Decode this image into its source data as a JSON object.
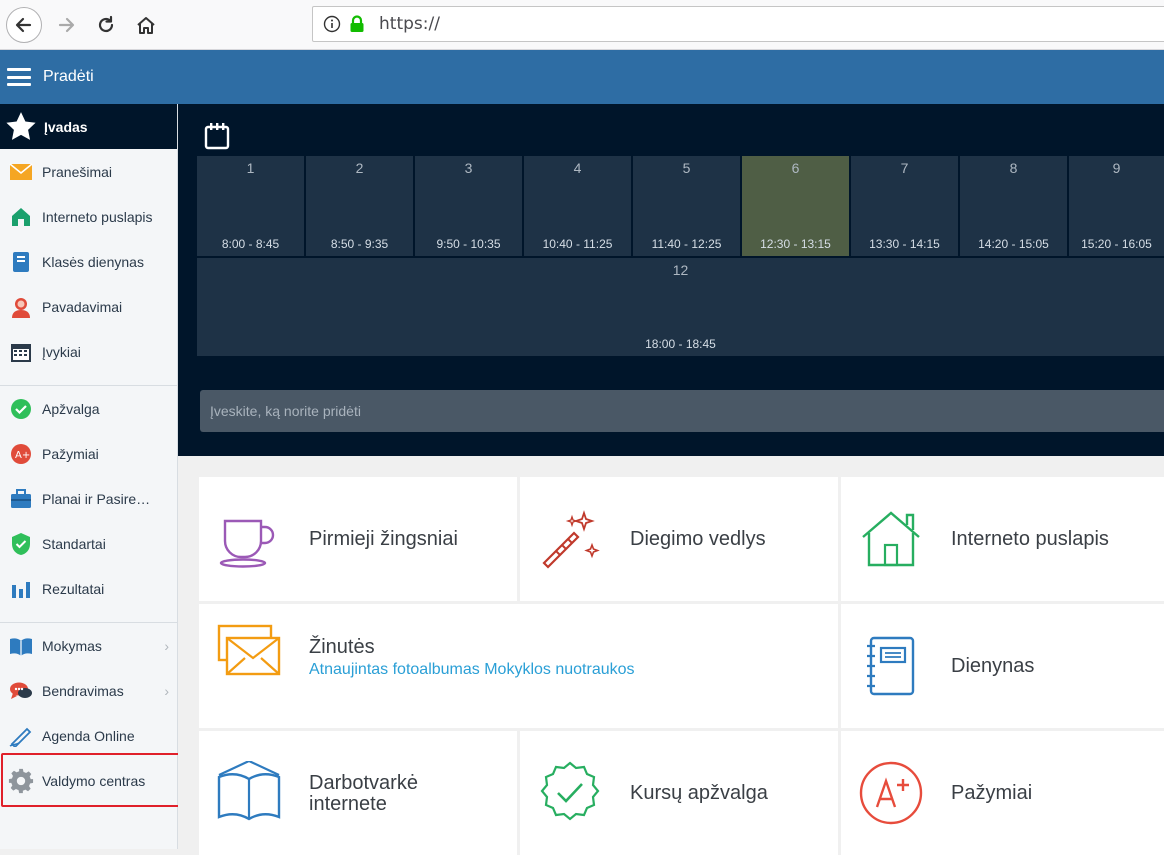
{
  "browser": {
    "url": "https://"
  },
  "header": {
    "title": "Pradėti"
  },
  "sidebar": {
    "top_label": "Įvadas",
    "group1": [
      {
        "label": "Pranešimai",
        "icon": "envelope-icon"
      },
      {
        "label": "Interneto puslapis",
        "icon": "home-icon"
      },
      {
        "label": "Klasės dienynas",
        "icon": "notebook-icon"
      },
      {
        "label": "Pavadavimai",
        "icon": "person-icon"
      },
      {
        "label": "Įvykiai",
        "icon": "calendar-icon"
      }
    ],
    "group2": [
      {
        "label": "Apžvalga",
        "icon": "check-circle-icon"
      },
      {
        "label": "Pažymiai",
        "icon": "grade-icon"
      },
      {
        "label": "Planai ir Pasire…",
        "icon": "briefcase-icon"
      },
      {
        "label": "Standartai",
        "icon": "shield-check-icon"
      },
      {
        "label": "Rezultatai",
        "icon": "bar-chart-icon"
      }
    ],
    "group3": [
      {
        "label": "Mokymas",
        "icon": "book-icon"
      },
      {
        "label": "Bendravimas",
        "icon": "chat-icon"
      },
      {
        "label": "Agenda Online",
        "icon": "pen-icon"
      },
      {
        "label": "Valdymo centras",
        "icon": "gear-icon"
      }
    ]
  },
  "schedule": {
    "periods": [
      {
        "num": "1",
        "time": "8:00 - 8:45"
      },
      {
        "num": "2",
        "time": "8:50 - 9:35"
      },
      {
        "num": "3",
        "time": "9:50 - 10:35"
      },
      {
        "num": "4",
        "time": "10:40 - 11:25"
      },
      {
        "num": "5",
        "time": "11:40 - 12:25"
      },
      {
        "num": "6",
        "time": "12:30 - 13:15"
      },
      {
        "num": "7",
        "time": "13:30 - 14:15"
      },
      {
        "num": "8",
        "time": "14:20 - 15:05"
      },
      {
        "num": "9",
        "time": "15:20 - 16:05"
      },
      {
        "num": "12",
        "time": "18:00 - 18:45"
      }
    ],
    "active_period": "6",
    "add_placeholder": "Įveskite, ką norite pridėti"
  },
  "tiles": {
    "first_steps": "Pirmieji žingsniai",
    "setup_wizard": "Diegimo vedlys",
    "website": "Interneto puslapis",
    "messages": "Žinutės",
    "messages_sub": "Atnaujintas fotoalbumas Mokyklos nuotraukos",
    "journal": "Dienynas",
    "agenda_line1": "Darbotvarkė",
    "agenda_line2": "internete",
    "course_overview": "Kursų apžvalga",
    "grades": "Pažymiai"
  },
  "colors": {
    "header_blue": "#2e6da4",
    "dark_navy": "#00152a",
    "highlight_red": "#e0202a",
    "link_blue": "#2a9fd6"
  }
}
